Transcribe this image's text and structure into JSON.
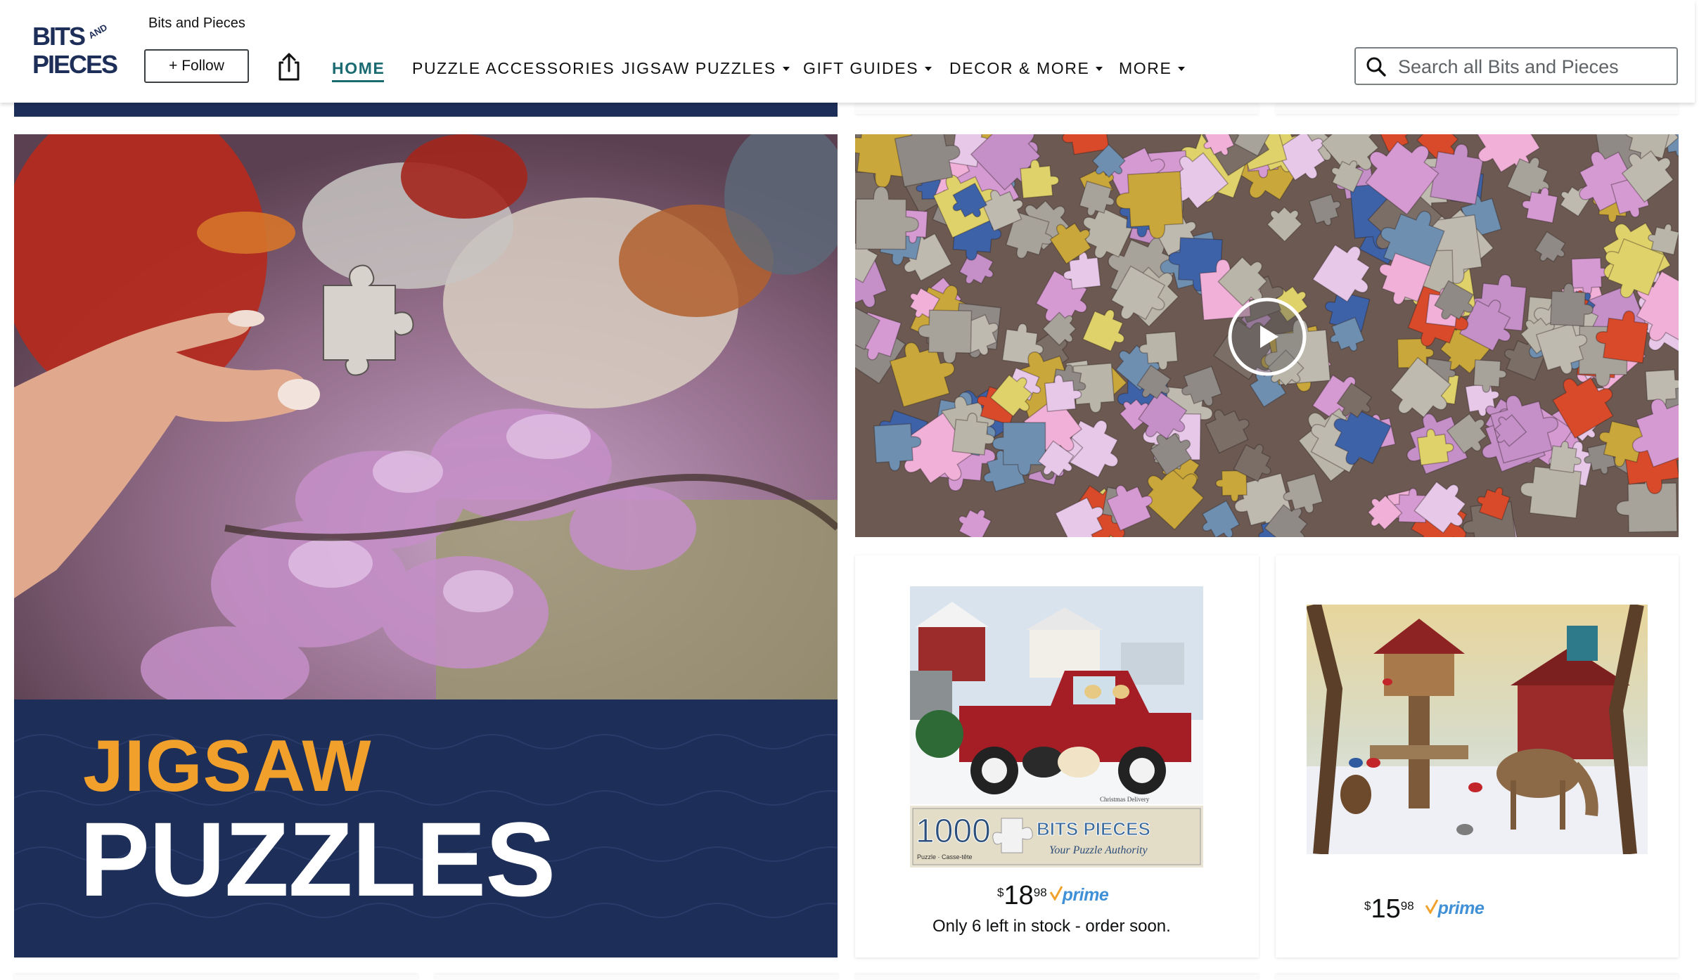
{
  "store": {
    "name": "Bits and Pieces",
    "logo_text_line1": "BITS",
    "logo_text_and": "AND",
    "logo_text_line2": "PIECES",
    "follow_label": "+ Follow",
    "share_icon": "share-icon"
  },
  "nav": {
    "items": [
      {
        "label": "HOME",
        "active": true,
        "dropdown": false
      },
      {
        "label": "PUZZLE ACCESSORIES",
        "active": false,
        "dropdown": false
      },
      {
        "label": "JIGSAW PUZZLES",
        "active": false,
        "dropdown": true
      },
      {
        "label": "GIFT GUIDES",
        "active": false,
        "dropdown": true
      },
      {
        "label": "DECOR & MORE",
        "active": false,
        "dropdown": true
      },
      {
        "label": "MORE",
        "active": false,
        "dropdown": true
      }
    ],
    "active_color": "#1a6a72"
  },
  "search": {
    "placeholder": "Search all Bits and Pieces",
    "value": ""
  },
  "hero": {
    "line1": "JIGSAW",
    "line2": "PUZZLES",
    "line1_color": "#f1a02b",
    "banner_color": "#1d2e59"
  },
  "video": {
    "play_icon": "play-icon"
  },
  "products": [
    {
      "image_count_text": "1000",
      "image_sub_text": "Puzzle · Casse-tête",
      "image_brand_text": "BITS PIECES",
      "image_tagline": "Your Puzzle Authority",
      "image_title": "Christmas Delivery",
      "price_currency": "$",
      "price_whole": "18",
      "price_fraction": "98",
      "prime_label": "prime",
      "availability": "Only 6 left in stock - order soon."
    },
    {
      "price_currency": "$",
      "price_whole": "15",
      "price_fraction": "98",
      "prime_label": "prime",
      "availability": ""
    }
  ],
  "colors": {
    "navy": "#1d2e59",
    "prime_blue": "#3f90d6",
    "orange": "#f1a02b"
  }
}
